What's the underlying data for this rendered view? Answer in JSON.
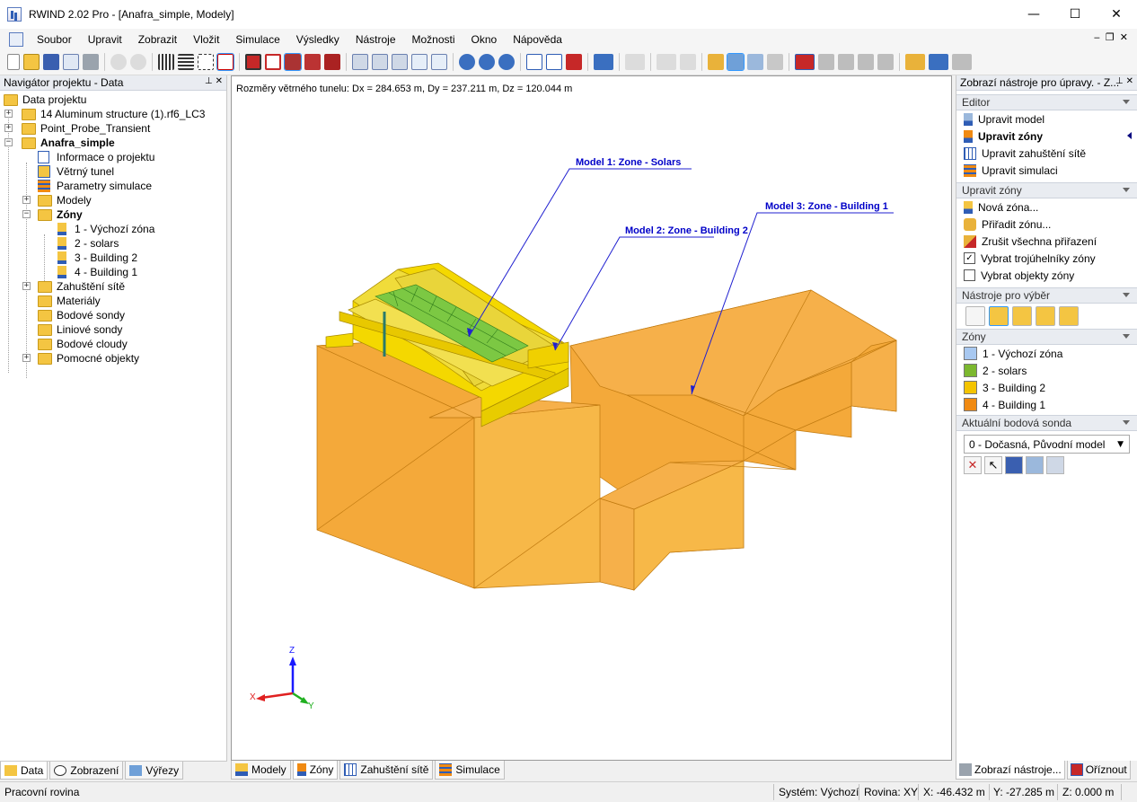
{
  "window": {
    "title": "RWIND 2.02 Pro - [Anafra_simple, Modely]",
    "minimize": "—",
    "maximize": "☐",
    "close": "✕"
  },
  "menu": [
    "Soubor",
    "Upravit",
    "Zobrazit",
    "Vložit",
    "Simulace",
    "Výsledky",
    "Nástroje",
    "Možnosti",
    "Okno",
    "Nápověda"
  ],
  "navigator": {
    "title": "Navigátor projektu - Data",
    "root": "Data projektu",
    "items": [
      {
        "label": "14 Aluminum structure (1).rf6_LC3"
      },
      {
        "label": "Point_Probe_Transient"
      },
      {
        "label": "Anafra_simple"
      },
      {
        "label": "Informace o projektu"
      },
      {
        "label": "Větrný tunel"
      },
      {
        "label": "Parametry simulace"
      },
      {
        "label": "Modely"
      },
      {
        "label": "Zóny"
      },
      {
        "label": "1 - Výchozí zóna"
      },
      {
        "label": "2 - solars"
      },
      {
        "label": "3 - Building 2"
      },
      {
        "label": "4 - Building 1"
      },
      {
        "label": "Zahuštění sítě"
      },
      {
        "label": "Materiály"
      },
      {
        "label": "Bodové sondy"
      },
      {
        "label": "Liniové sondy"
      },
      {
        "label": "Bodové cloudy"
      },
      {
        "label": "Pomocné objekty"
      }
    ],
    "tabs": [
      "Data",
      "Zobrazení",
      "Výřezy"
    ]
  },
  "viewport": {
    "dimensions": "Rozměry větrného tunelu: Dx = 284.653 m, Dy = 237.211 m, Dz = 120.044 m",
    "annotations": [
      "Model 1: Zone - Solars",
      "Model 2: Zone - Building 2",
      "Model 3: Zone - Building 1"
    ],
    "axes": {
      "x": "X",
      "y": "Y",
      "z": "Z"
    },
    "tabs": [
      "Modely",
      "Zóny",
      "Zahuštění sítě",
      "Simulace"
    ]
  },
  "right_panel": {
    "title": "Zobrazí nástroje pro úpravy. - Z...",
    "editor_header": "Editor",
    "editor_items": [
      "Upravit model",
      "Upravit zóny",
      "Upravit zahuštění sítě",
      "Upravit simulaci"
    ],
    "zone_edit_header": "Upravit zóny",
    "zone_edit_items": [
      "Nová zóna...",
      "Přiřadit zónu...",
      "Zrušit všechna přiřazení",
      "Vybrat trojúhelníky zóny",
      "Vybrat objekty zóny"
    ],
    "selection_header": "Nástroje pro výběr",
    "zones_header": "Zóny",
    "zones": [
      {
        "label": "1 - Výchozí zóna",
        "color": "#a8c8f0"
      },
      {
        "label": "2 - solars",
        "color": "#7cb82f"
      },
      {
        "label": "3 - Building 2",
        "color": "#f4c400"
      },
      {
        "label": "4 - Building 1",
        "color": "#f08a12"
      }
    ],
    "probe_header": "Aktuální bodová sonda",
    "probe_value": "0 - Dočasná, Původní model",
    "tabs": [
      "Zobrazí nástroje...",
      "Oříznout"
    ]
  },
  "status": {
    "left": "Pracovní rovina",
    "system": "Systém: Výchozí",
    "plane": "Rovina: XY",
    "x": "X:  -46.432 m",
    "y": "Y:  -27.285 m",
    "z": "Z:  0.000 m"
  }
}
